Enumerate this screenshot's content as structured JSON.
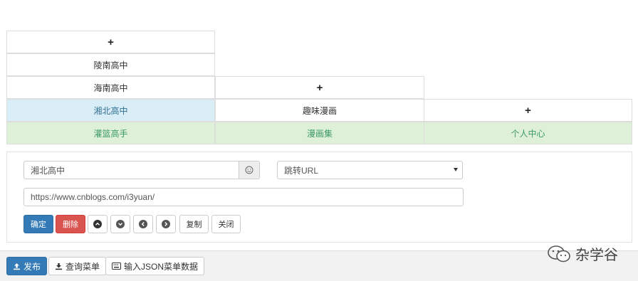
{
  "menu": {
    "col1": {
      "add_label": "+",
      "submenu": [
        "陵南高中",
        "海南高中",
        "湘北高中"
      ],
      "main_label": "灌篮高手"
    },
    "col2": {
      "add_label": "+",
      "submenu": [
        "趣味漫画"
      ],
      "main_label": "漫画集"
    },
    "col3": {
      "add_label": "+",
      "main_label": "个人中心"
    }
  },
  "editor": {
    "name_value": "湘北高中",
    "type_select": "跳转URL",
    "url_value": "https://www.cnblogs.com/i3yuan/",
    "buttons": {
      "confirm": "确定",
      "delete": "删除",
      "copy": "复制",
      "close": "关闭"
    }
  },
  "toolbar": {
    "publish": "发布",
    "query_menu": "查询菜单",
    "input_json": "输入JSON菜单数据"
  },
  "watermark": {
    "text": "杂学谷"
  },
  "colors": {
    "selected_bg": "#d9edf7",
    "footer_bg": "#dff0d8",
    "primary": "#337ab7",
    "danger": "#d9534f"
  }
}
